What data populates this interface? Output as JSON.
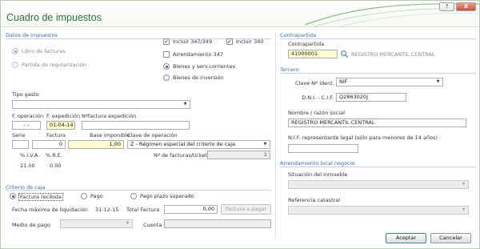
{
  "window": {
    "title": "Cuadro de impuestos",
    "help_label": "?",
    "close_label": "X"
  },
  "datos": {
    "section": "Datos de impuestos",
    "libro_facturas": "Libro de facturas",
    "partida_regularizacion": "Partida de regularización",
    "incluir_347_349": "Incluir 347/349",
    "incluir_340": "Incluir 340",
    "arrendamiento_347": "Arrendamiento 347",
    "bienes_serv": "Bienes y serv.corrientes",
    "bienes_inversion": "Bienes de inversión",
    "tipo_gasto_label": "Tipo gasto",
    "tipo_gasto_value": "",
    "f_operacion_label": "F. operación",
    "f_operacion_value": "- -",
    "f_expedicion_label": "F. expedición",
    "f_expedicion_value": "01-04-14",
    "n_factura_label": "Nºfactura expedición",
    "n_factura_value": "",
    "serie_label": "Serie",
    "serie_value": "",
    "factura_label": "Factura",
    "factura_value": "0",
    "base_label": "Base imponible",
    "base_value": "1,00",
    "clave_label": "Clave de operación",
    "clave_value": "Z - Régimen especial del criterio de caja",
    "n_facturas_label": "Nº de facturas/tickets",
    "n_facturas_value": "1",
    "iva_label": "% I.V.A.",
    "iva_value": "21.00",
    "re_label": "% R.E.",
    "re_value": "0.00"
  },
  "criterio": {
    "section": "Criterio de caja",
    "factura_recibida": "Factura recibida",
    "pago": "Pago",
    "pago_plazo": "Pago plazo superado",
    "fecha_max_label": "Fecha máxima de liquidación",
    "fecha_max_value": "31-12-15",
    "total_factura_label": "Total Factura",
    "total_factura_value": "0,00",
    "factura_a_pagar": "Factura a pagar",
    "medio_pago_label": "Medio de pago",
    "medio_pago_value": "",
    "cuenta_label": "Cuenta",
    "cuenta_value": ""
  },
  "contrapartida": {
    "section": "Contrapartida",
    "label": "Contrapartida",
    "code": "41000001",
    "name": "REGISTRO MERCANTIL CENTRAL"
  },
  "tercero": {
    "section": "Tercero",
    "clave_ident_label": "Clave Nº ident.",
    "clave_ident_value": "NIF",
    "dni_label": "D.N.I. - C.I.F.",
    "dni_value": "Q2863020J",
    "nombre_label": "Nombre / razón social",
    "nombre_value": "REGISTRO MERCANTIL CENTRAL",
    "nif_repr_label": "N.I.F. representante legal (sólo para menores de 14 años)",
    "nif_repr_value": ""
  },
  "arrendamiento": {
    "section": "Arrendamiento local negocio",
    "situacion_label": "Situación del inmueble",
    "situacion_value": "",
    "referencia_label": "Referencia catastral",
    "referencia_value": ""
  },
  "actions": {
    "aceptar": "Aceptar",
    "cancelar": "Cancelar"
  },
  "colors": {
    "title": "#2f6f3c",
    "section": "#3a6ca8",
    "highlight_field": "#fefbd0"
  }
}
